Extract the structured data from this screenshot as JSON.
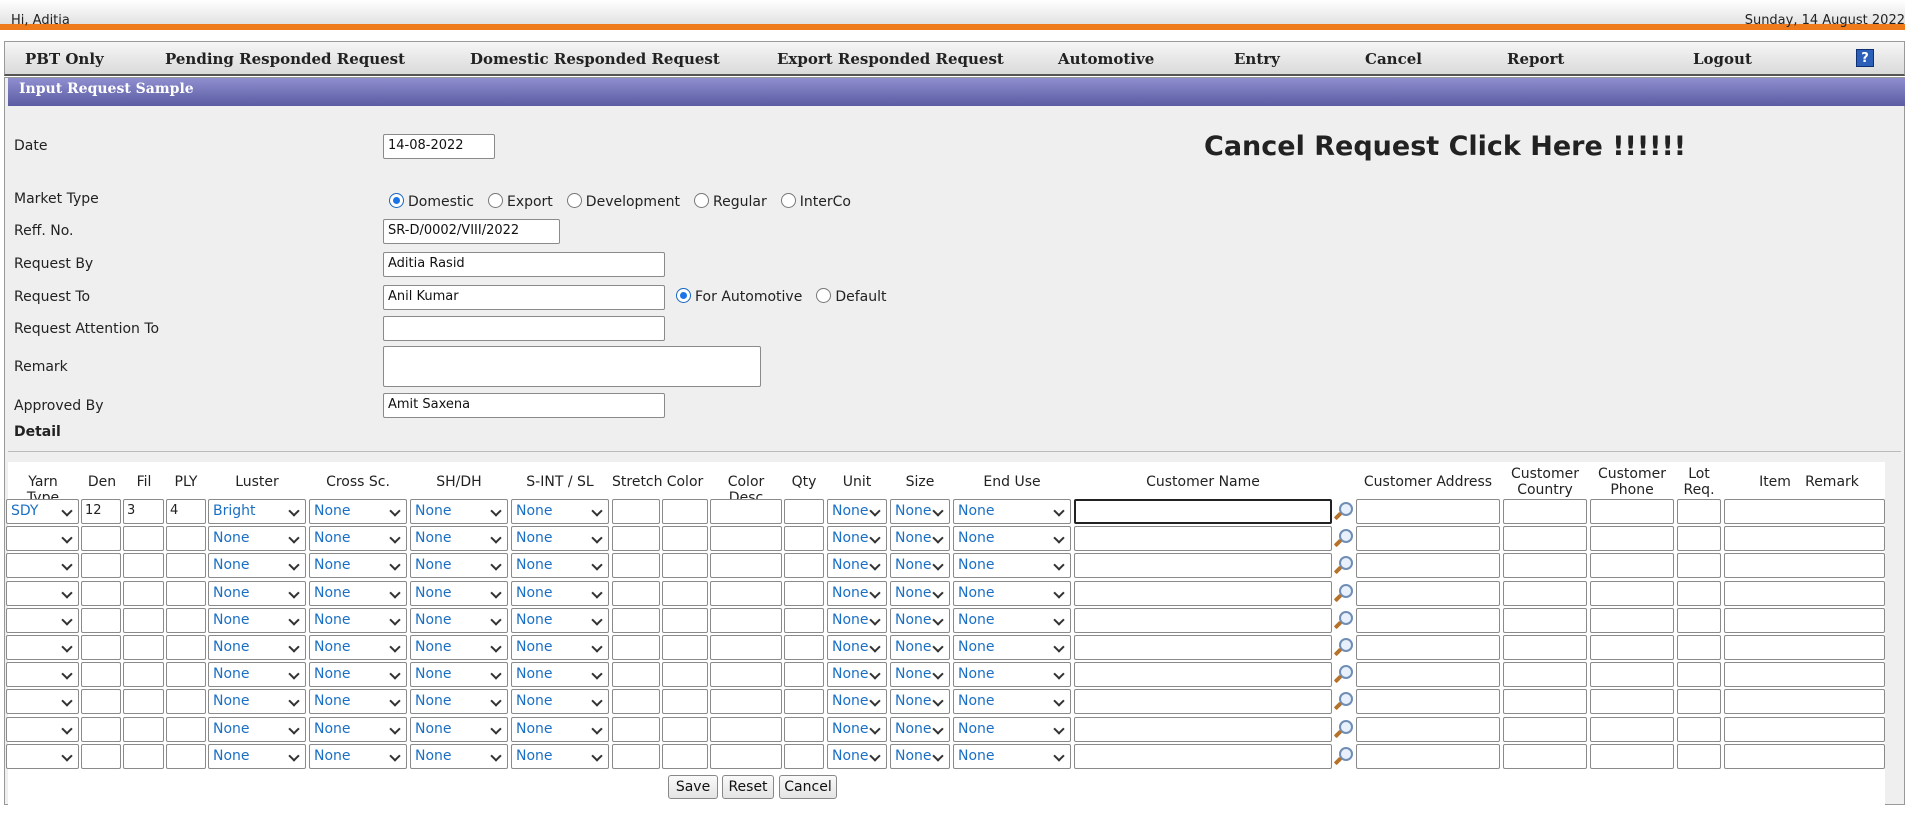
{
  "header": {
    "greeting": "Hi, Aditia",
    "date": "Sunday, 14 August 2022"
  },
  "nav": {
    "items": [
      "PBT Only",
      "Pending Responded Request",
      "Domestic Responded Request",
      "Export Responded Request",
      "Automotive",
      "Entry",
      "Cancel",
      "Report",
      "Logout"
    ],
    "help_icon": "?"
  },
  "panel": {
    "title": "Input Request Sample"
  },
  "form": {
    "date_label": "Date",
    "date_value": "14-08-2022",
    "cancel_link": "Cancel Request Click Here !!!!!!",
    "market_type_label": "Market Type",
    "market_types": [
      "Domestic",
      "Export",
      "Development",
      "Regular",
      "InterCo"
    ],
    "market_type_selected": "Domestic",
    "reff_label": "Reff. No.",
    "reff_value": "SR-D/0002/VIII/2022",
    "request_by_label": "Request By",
    "request_by_value": "Aditia Rasid",
    "request_to_label": "Request To",
    "request_to_value": "Anil Kumar",
    "request_to_options": [
      "For Automotive",
      "Default"
    ],
    "request_to_selected": "For Automotive",
    "attention_label": "Request Attention To",
    "attention_value": "",
    "remark_label": "Remark",
    "remark_value": "",
    "approved_label": "Approved By",
    "approved_value": "Amit Saxena"
  },
  "detail": {
    "heading": "Detail",
    "columns": [
      "Yarn Type",
      "Den",
      "Fil",
      "PLY",
      "Luster",
      "Cross Sc.",
      "SH/DH",
      "S-INT / SL",
      "Stretch",
      "Color",
      "Color Desc",
      "Qty",
      "Unit",
      "Size",
      "End Use",
      "Customer Name",
      "Customer Address",
      "Customer Country",
      "Customer Phone",
      "Lot Req.",
      "Item",
      "Remark"
    ],
    "rows": [
      {
        "yarn_type": "SDY",
        "den": "12",
        "fil": "3",
        "ply": "4",
        "luster": "Bright",
        "cross": "None",
        "shdh": "None",
        "sint": "None",
        "unit": "None",
        "size": "None",
        "end_use": "None"
      },
      {
        "yarn_type": "",
        "den": "",
        "fil": "",
        "ply": "",
        "luster": "None",
        "cross": "None",
        "shdh": "None",
        "sint": "None",
        "unit": "None",
        "size": "None",
        "end_use": "None"
      },
      {
        "yarn_type": "",
        "den": "",
        "fil": "",
        "ply": "",
        "luster": "None",
        "cross": "None",
        "shdh": "None",
        "sint": "None",
        "unit": "None",
        "size": "None",
        "end_use": "None"
      },
      {
        "yarn_type": "",
        "den": "",
        "fil": "",
        "ply": "",
        "luster": "None",
        "cross": "None",
        "shdh": "None",
        "sint": "None",
        "unit": "None",
        "size": "None",
        "end_use": "None"
      },
      {
        "yarn_type": "",
        "den": "",
        "fil": "",
        "ply": "",
        "luster": "None",
        "cross": "None",
        "shdh": "None",
        "sint": "None",
        "unit": "None",
        "size": "None",
        "end_use": "None"
      },
      {
        "yarn_type": "",
        "den": "",
        "fil": "",
        "ply": "",
        "luster": "None",
        "cross": "None",
        "shdh": "None",
        "sint": "None",
        "unit": "None",
        "size": "None",
        "end_use": "None"
      },
      {
        "yarn_type": "",
        "den": "",
        "fil": "",
        "ply": "",
        "luster": "None",
        "cross": "None",
        "shdh": "None",
        "sint": "None",
        "unit": "None",
        "size": "None",
        "end_use": "None"
      },
      {
        "yarn_type": "",
        "den": "",
        "fil": "",
        "ply": "",
        "luster": "None",
        "cross": "None",
        "shdh": "None",
        "sint": "None",
        "unit": "None",
        "size": "None",
        "end_use": "None"
      },
      {
        "yarn_type": "",
        "den": "",
        "fil": "",
        "ply": "",
        "luster": "None",
        "cross": "None",
        "shdh": "None",
        "sint": "None",
        "unit": "None",
        "size": "None",
        "end_use": "None"
      },
      {
        "yarn_type": "",
        "den": "",
        "fil": "",
        "ply": "",
        "luster": "None",
        "cross": "None",
        "shdh": "None",
        "sint": "None",
        "unit": "None",
        "size": "None",
        "end_use": "None"
      }
    ]
  },
  "buttons": {
    "save": "Save",
    "reset": "Reset",
    "cancel": "Cancel"
  },
  "colors": {
    "accent_orange": "#ee7a1c",
    "title_bar": "#6a6ab2",
    "link_blue": "#1a6fc4"
  }
}
